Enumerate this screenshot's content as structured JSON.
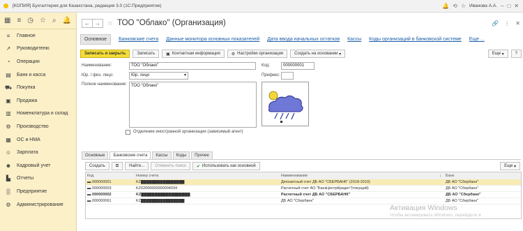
{
  "window": {
    "title": "[КОПИЯ] Бухгалтерия для Казахстана, редакция 3.0 (1С:Предприятие)",
    "user": "Иванова А.А."
  },
  "sidebar": {
    "items": [
      {
        "label": "Главное",
        "icon": "menu-icon"
      },
      {
        "label": "Руководителю",
        "icon": "chart-icon"
      },
      {
        "label": "Операции",
        "icon": "operations-icon"
      },
      {
        "label": "Банк и касса",
        "icon": "bank-icon"
      },
      {
        "label": "Покупка",
        "icon": "cart-icon"
      },
      {
        "label": "Продажа",
        "icon": "sales-icon"
      },
      {
        "label": "Номенклатура и склад",
        "icon": "warehouse-icon"
      },
      {
        "label": "Производство",
        "icon": "production-icon"
      },
      {
        "label": "ОС и НМА",
        "icon": "assets-icon"
      },
      {
        "label": "Зарплата",
        "icon": "salary-icon"
      },
      {
        "label": "Кадровый учет",
        "icon": "hr-icon"
      },
      {
        "label": "Отчеты",
        "icon": "reports-icon"
      },
      {
        "label": "Предприятие",
        "icon": "enterprise-icon"
      },
      {
        "label": "Администрирование",
        "icon": "settings-icon"
      }
    ]
  },
  "form": {
    "title": "ТОО \"Облако\" (Организация)",
    "tabs": [
      "Основное",
      "Банковские счета",
      "Данные монитора основных показателей",
      "Дата ввода начальных остатков",
      "Кассы",
      "Коды организаций в банковской системе",
      "Еще ..."
    ],
    "toolbar": {
      "save_close": "Записать и закрыть",
      "save": "Записать",
      "contact_info": "Контактная информация",
      "org_settings": "Настройки организации",
      "create_based": "Создать на основании",
      "more": "Еще"
    },
    "fields": {
      "name_label": "Наименование:",
      "name_value": "ТОО \"Облако\"",
      "code_label": "Код:",
      "code_value": "000000001",
      "type_label": "Юр. / физ. лицо:",
      "type_value": "Юр. лицо",
      "prefix_label": "Префикс:",
      "prefix_value": "",
      "full_name_label": "Полное наименование:",
      "full_name_value": "ТОО \"Облако\"",
      "foreign_label": "Отделение иностранной организации (зависимый агент)"
    },
    "inner_tabs": [
      "Основные",
      "Банковские счета",
      "Кассы",
      "Коды",
      "Прочее"
    ],
    "table_toolbar": {
      "create": "Создать",
      "find": "Найти...",
      "cancel_search": "Отменить поиск",
      "use_main": "Использовать как основной",
      "more": "Еще"
    },
    "table": {
      "headers": [
        "Код",
        "Номер счета",
        "Наименование",
        "Банк"
      ],
      "rows": [
        {
          "code": "000000001",
          "number": "KZ████████████████",
          "name": "Депозитный счет ДБ АО \"СБЕРБАНК\" (2018-2019)",
          "bank": "ДБ АО \"Сбербанк\"",
          "selected": true,
          "bold": false
        },
        {
          "code": "000000003",
          "number": "KZ02000000000004034",
          "name": "Расчетный счет АО \"БанкЦентрКредит\"(текущий)",
          "bank": "ДБ АО \"Сбербанк\"",
          "selected": false,
          "bold": false
        },
        {
          "code": "000000002",
          "number": "KZ██████████████████",
          "name": "Расчетный счет ДБ АО \"СБЕРБАНК\"",
          "bank": "ДБ АО \"Сбербанк\"",
          "selected": false,
          "bold": true
        },
        {
          "code": "000000061",
          "number": "KZ████████████████",
          "name": "ДБ АО \"Сбербанк\"",
          "bank": "ДБ АО \"Сбербанк\"",
          "selected": false,
          "bold": false
        }
      ]
    }
  },
  "watermark": {
    "line1": "Активация Windows",
    "line2": "Чтобы активировать Windows, перейдите в"
  },
  "colors": {
    "sidebar_bg": "#fbf0c8",
    "primary_button": "#f5dd34",
    "link": "#1a5ca8",
    "selected_row": "#f8ecb4"
  }
}
